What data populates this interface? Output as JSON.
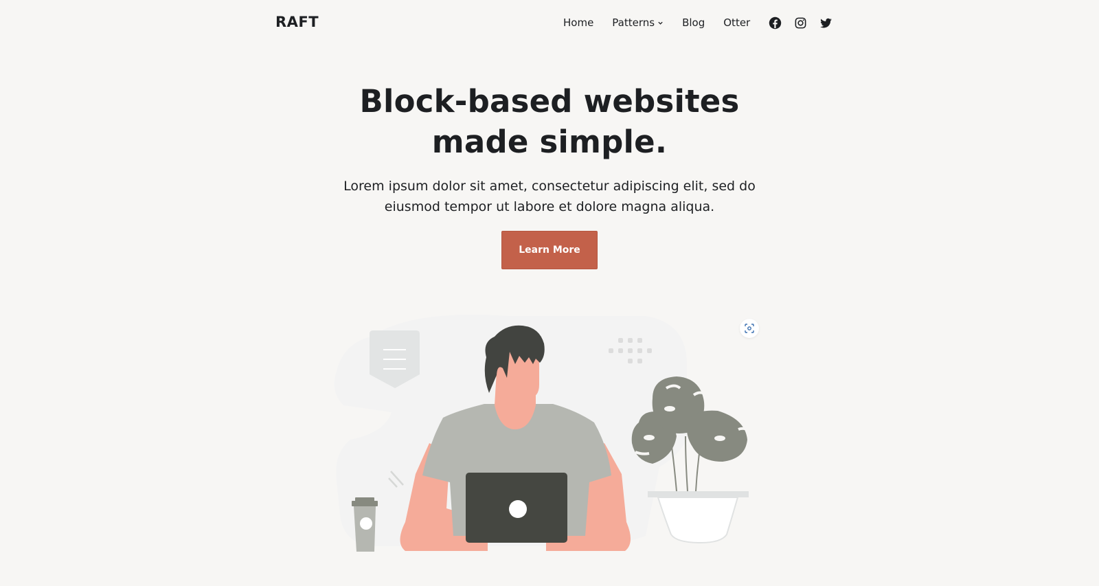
{
  "header": {
    "logo": "RAFT",
    "nav": [
      {
        "label": "Home"
      },
      {
        "label": "Patterns",
        "has_dropdown": true
      },
      {
        "label": "Blog"
      },
      {
        "label": "Otter"
      }
    ],
    "social": [
      {
        "icon": "facebook-icon"
      },
      {
        "icon": "instagram-icon"
      },
      {
        "icon": "twitter-icon"
      }
    ]
  },
  "hero": {
    "title_lines": [
      "Block-based websites",
      "made simple."
    ],
    "subtitle_lines": [
      "Lorem ipsum dolor sit amet, consectetur adipiscing elit, sed do",
      "eiusmod tempor ut labore et dolore magna aliqua."
    ],
    "cta_label": "Learn More"
  },
  "colors": {
    "background": "#f7f6f4",
    "text": "#1d1f22",
    "accent": "#c3614a",
    "skin": "#f5ab99",
    "shirt": "#b5b7b1",
    "hair": "#424440",
    "laptop": "#454741",
    "plant": "#878a80"
  },
  "illustration": {
    "icon": "person-working-on-laptop",
    "overlay_button_icon": "visual-search-icon"
  }
}
